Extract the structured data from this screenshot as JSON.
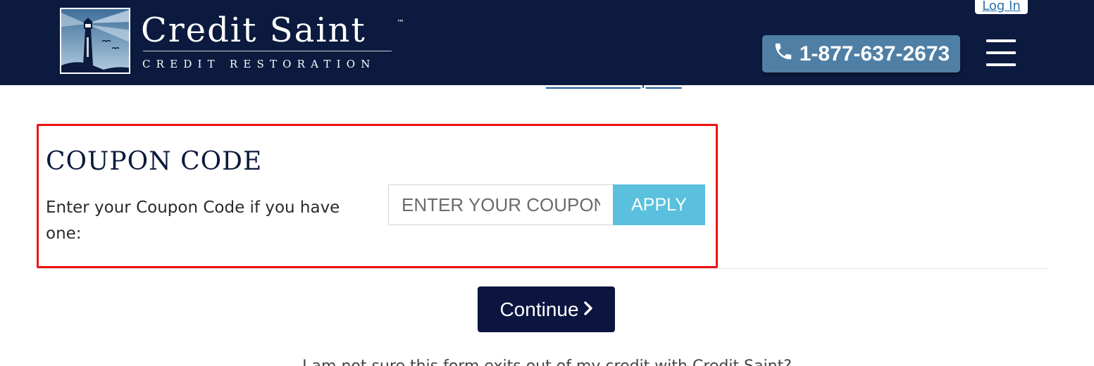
{
  "header": {
    "brand_name": "Credit Saint",
    "brand_tm": "™",
    "brand_subtitle": "CREDIT RESTORATION",
    "login_label": "Log In",
    "phone_icon": "phone-icon",
    "phone_number": "1-877-637-2673",
    "menu_icon": "hamburger-menu-icon",
    "logo_icon": "lighthouse-logo-icon"
  },
  "coupon_link": "Have a coupon?",
  "coupon": {
    "title": "COUPON CODE",
    "description": "Enter your Coupon Code if you have one:",
    "input_value": "",
    "input_placeholder": "ENTER YOUR COUPON",
    "apply_label": "APPLY"
  },
  "continue_label": "Continue",
  "continue_icon": "chevron-right-icon",
  "footer_text": "I am not sure this form exits out of my credit with Credit Saint?",
  "colors": {
    "header_bg": "#0b1a3e",
    "phone_button": "#4f7fa5",
    "apply_button": "#5bc0de",
    "continue_button": "#0b1540",
    "highlight_border": "#ee1111",
    "link": "#1a5a96"
  }
}
